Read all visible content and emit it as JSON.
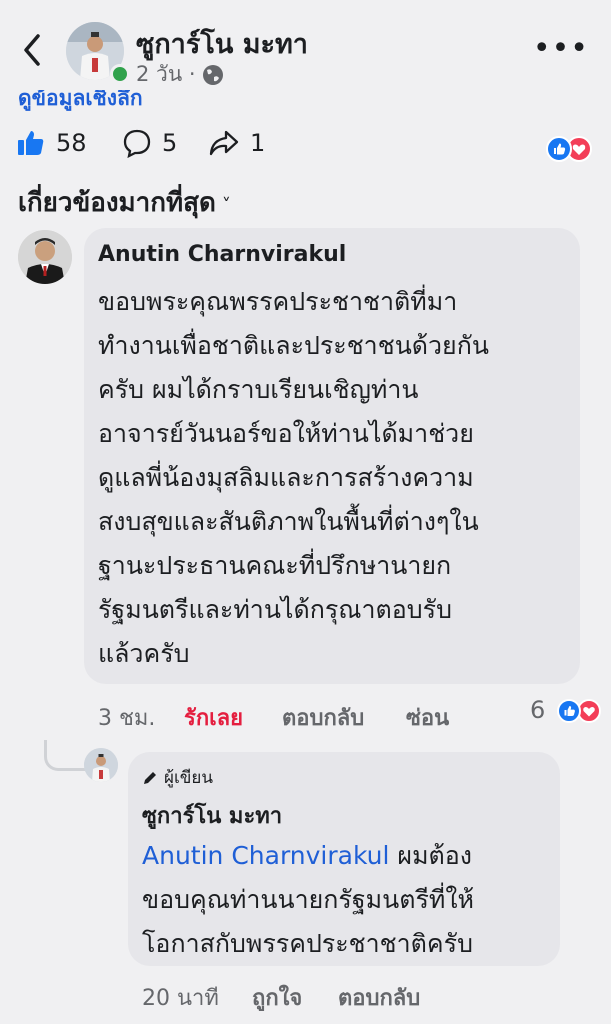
{
  "header": {
    "back_icon": "chevron-left-icon",
    "name": "ซูการ์โน มะทา",
    "time": "2 วัน ·",
    "privacy_icon": "globe-icon",
    "more_icon": "more-icon"
  },
  "post": {
    "see_info_link": "ดูข้อมูลเชิงลึก",
    "likes": "58",
    "comments": "5",
    "shares": "1",
    "reaction_icons": [
      "like-icon",
      "love-icon"
    ]
  },
  "filter": {
    "label": "เกี่ยวข้องมากที่สุด",
    "chevron": "˅"
  },
  "comment": {
    "author": "Anutin Charnvirakul",
    "lines": [
      "ขอบพระคุณพรรคประชาชาติที่มา",
      "ทำงานเพื่อชาติและประชาชนด้วยกัน",
      "ครับ ผมได้กราบเรียนเชิญท่าน",
      "อาจารย์วันนอร์ขอให้ท่านได้มาช่วย",
      "ดูแลพี่น้องมุสลิมและการสร้างความ",
      "สงบสุขและสันติภาพในพื้นที่ต่างๆใน",
      "ฐานะประธานคณะที่ปรึกษานายก",
      "รัฐมนตรีและท่านได้กรุณาตอบรับ",
      "แล้วครับ"
    ],
    "time": "3 ชม.",
    "love_label": "รักเลย",
    "reply_label": "ตอบกลับ",
    "hide_label": "ซ่อน",
    "reaction_count": "6"
  },
  "reply": {
    "author_badge": "ผู้เขียน",
    "author": "ซูการ์โน มะทา",
    "mention": "Anutin Charnvirakul",
    "line1_rest": " ผมต้อง",
    "line2": "ขอบคุณท่านนายกรัฐมนตรีที่ให้",
    "line3": "โอกาสกับพรรคประชาชาติครับ",
    "time": "20 นาที",
    "like_label": "ถูกใจ",
    "reply_label": "ตอบกลับ"
  },
  "colors": {
    "link_blue": "#1f5fd6",
    "love_red": "#e41e3f",
    "online_green": "#31a24c"
  }
}
